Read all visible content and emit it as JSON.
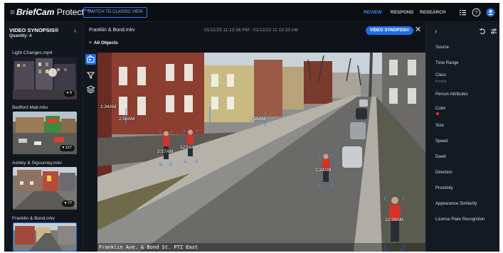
{
  "brand": {
    "name": "BriefCam",
    "product": "Protect",
    "beta": "Beta"
  },
  "topbar": {
    "classic_button": "SWITCH TO CLASSIC VIEW",
    "nav": [
      "REVIEW",
      "RESPOND",
      "RESEARCH"
    ],
    "active_nav": "REVIEW",
    "accent": "#1f6fe5"
  },
  "left_panel": {
    "title": "VIDEO SYNOPSIS®",
    "quantity": "Quantity: 4",
    "videos": [
      {
        "name": "Light Changes.mp4",
        "count": "9"
      },
      {
        "name": "Bedford Mall.mkv",
        "count": "127"
      },
      {
        "name": "Ashley & Sigourney.mkv",
        "count": "77"
      },
      {
        "name": "Franklin & Bond.mkv",
        "count": ""
      }
    ]
  },
  "main": {
    "clip_title": "Franklin & Bond.mkv",
    "time_range": "01/11/23 11:13:36 PM - 01/12/23 11:13:33 AM",
    "mode_pill": "VIDEO SYNOPSIS®",
    "filter_label": "All Objects",
    "video_overlay": "Franklin Ave. & Bond St. PTZ East",
    "object_timestamps": [
      "1:34AM",
      "2:56AM",
      "4:16AM",
      "2:57AM",
      "12:58AM",
      "1:24AM",
      "12:39AM"
    ]
  },
  "right_panel": {
    "filters": [
      {
        "label": "Source"
      },
      {
        "label": "Time Range"
      },
      {
        "label": "Class",
        "sub": "People"
      },
      {
        "label": "Person Attributes"
      },
      {
        "label": "Color",
        "dot": "#e53935"
      },
      {
        "label": "Size"
      },
      {
        "label": "Speed"
      },
      {
        "label": "Dwell"
      },
      {
        "label": "Direction"
      },
      {
        "label": "Proximity"
      },
      {
        "label": "Appearance Similarity"
      },
      {
        "label": "License Plate Recognition"
      }
    ]
  },
  "icons": [
    "menu-lines-icon",
    "keyboard-shortcuts-icon",
    "help-icon",
    "user-avatar-icon",
    "collapse-left-icon",
    "close-icon",
    "expand-right-icon",
    "undo-icon",
    "sliders-icon",
    "synopsis-tool-icon",
    "filter-funnel-icon",
    "layers-icon"
  ]
}
